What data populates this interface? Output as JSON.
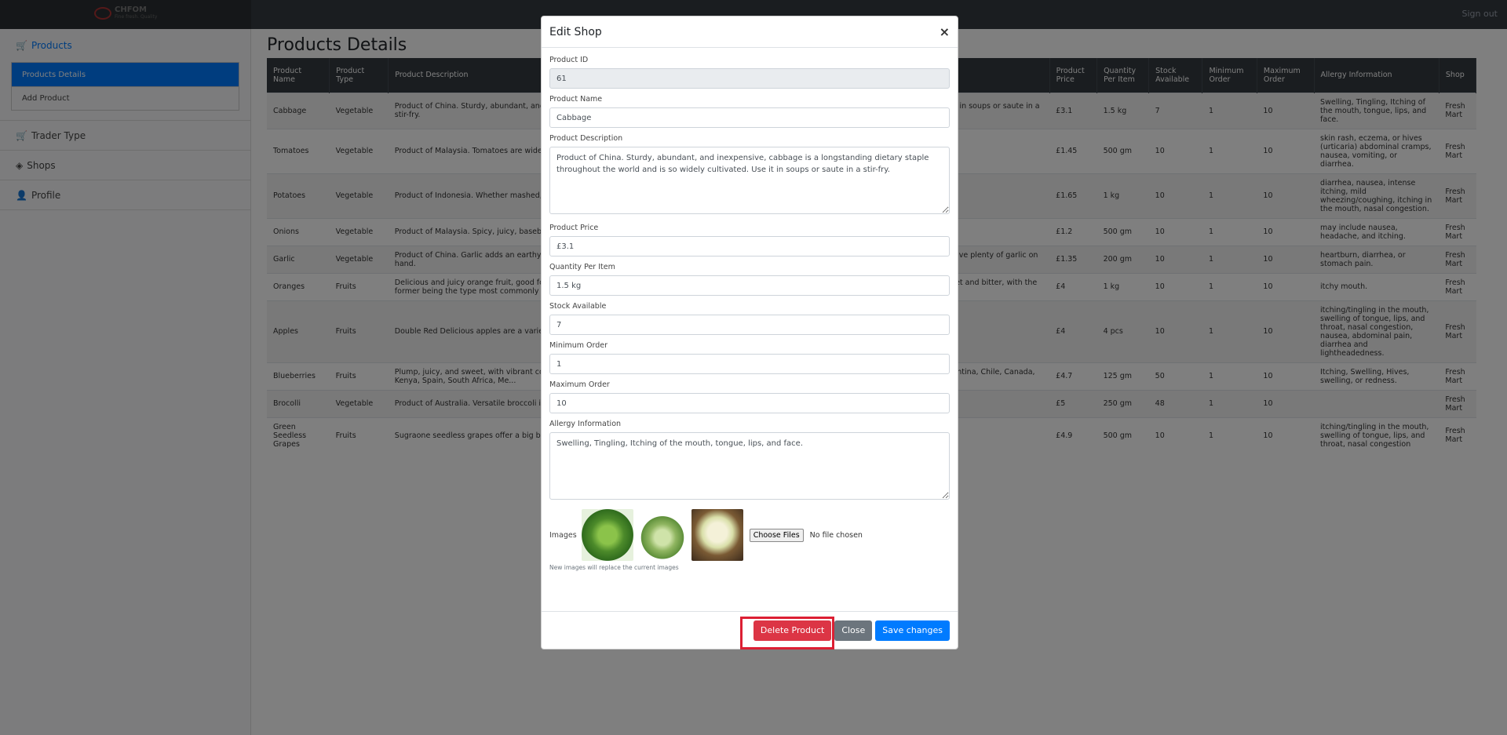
{
  "topbar": {
    "logo_text": "CHFOM",
    "logo_sub": "Fine fresh. Quality",
    "signout": "Sign out"
  },
  "sidebar": {
    "products": "Products",
    "products_details": "Products Details",
    "add_product": "Add Product",
    "trader_type": "Trader Type",
    "shops": "Shops",
    "profile": "Profile"
  },
  "main": {
    "title": "Products Details",
    "columns": [
      "Product Name",
      "Product Type",
      "Product Description",
      "Product Price",
      "Quantity Per Item",
      "Stock Available",
      "Minimum Order",
      "Maximum Order",
      "Allergy Information",
      "Shop"
    ],
    "rows": [
      {
        "name": "Cabbage",
        "type": "Vegetable",
        "desc": "Product of China. Sturdy, abundant, and inexpensive, cabbage is a longstanding dietary staple throughout the world and is so widely cultivated. Use it in soups or saute in a stir-fry.",
        "price": "£3.1",
        "qty": "1.5 kg",
        "stock": "7",
        "min": "1",
        "max": "10",
        "allergy": "Swelling, Tingling, Itching of the mouth, tongue, lips, and face.",
        "shop": "Fresh Mart"
      },
      {
        "name": "Tomatoes",
        "type": "Vegetable",
        "desc": "Product of Malaysia. Tomatoes are widely known...",
        "price": "£1.45",
        "qty": "500 gm",
        "stock": "10",
        "min": "1",
        "max": "10",
        "allergy": "skin rash, eczema, or hives (urticaria) abdominal cramps, nausea, vomiting, or diarrhea.",
        "shop": "Fresh Mart"
      },
      {
        "name": "Potatoes",
        "type": "Vegetable",
        "desc": "Product of Indonesia. Whether mashed, baked... vegetable crop in the world. Potatoes are available year-round as they are harvested...",
        "price": "£1.65",
        "qty": "1 kg",
        "stock": "10",
        "min": "1",
        "max": "10",
        "allergy": "diarrhea, nausea, intense itching, mild wheezing/coughing, itching in the mouth, nasal congestion.",
        "shop": "Fresh Mart"
      },
      {
        "name": "Onions",
        "type": "Vegetable",
        "desc": "Product of Malaysia. Spicy, juicy, baseball-sized... with flour and deep-fry for decadent onion rings. These tear-inducing onions are...",
        "price": "£1.2",
        "qty": "500 gm",
        "stock": "10",
        "min": "1",
        "max": "10",
        "allergy": "may include nausea, headache, and itching.",
        "shop": "Fresh Mart"
      },
      {
        "name": "Garlic",
        "type": "Vegetable",
        "desc": "Product of China. Garlic adds an earthy, robust... biting, and fresh. Garlic can also be roasted whole for a nutty and mellow flavor... ty flavor. Always have plenty of garlic on hand.",
        "price": "£1.35",
        "qty": "200 gm",
        "stock": "10",
        "min": "1",
        "max": "10",
        "allergy": "heartburn, diarrhea, or stomach pain.",
        "shop": "Fresh Mart"
      },
      {
        "name": "Oranges",
        "type": "Fruits",
        "desc": "Delicious and juicy orange fruit, good for juice... and overall well-being. Orange is a tropical to semitropical, evergreen, small flowering... egories, sweet and bitter, with the former being the type most commonly consumed.",
        "price": "£4",
        "qty": "1 kg",
        "stock": "10",
        "min": "1",
        "max": "10",
        "allergy": "itchy mouth.",
        "shop": "Fresh Mart"
      },
      {
        "name": "Apples",
        "type": "Fruits",
        "desc": "Double Red Delicious apples are a variety of... Red Delicious apple, with a bright white flesh, aromatic and sweet flavor and...",
        "price": "£4",
        "qty": "4 pcs",
        "stock": "10",
        "min": "1",
        "max": "10",
        "allergy": "itching/tingling in the mouth, swelling of tongue, lips, and throat, nasal congestion, nausea, abdominal pain, diarrhea and lightheadedness.",
        "shop": "Fresh Mart"
      },
      {
        "name": "Blueberries",
        "type": "Fruits",
        "desc": "Plump, juicy, and sweet, with vibrant colours... of nature\\'s great treasures. Blueberries have a sweet flavour that\\'s deli... orocco, USA, Australia, Argentina, Chile, Canada, Kenya, Spain, South Africa, Me...",
        "price": "£4.7",
        "qty": "125 gm",
        "stock": "50",
        "min": "1",
        "max": "10",
        "allergy": "Itching, Swelling, Hives, swelling, or redness.",
        "shop": "Fresh Mart"
      },
      {
        "name": "Brocolli",
        "type": "Vegetable",
        "desc": "Product of Australia. Versatile broccoli is deli...",
        "price": "£5",
        "qty": "250 gm",
        "stock": "48",
        "min": "1",
        "max": "10",
        "allergy": "",
        "shop": "Fresh Mart"
      },
      {
        "name": "Green Seedless Grapes",
        "type": "Fruits",
        "desc": "Sugraone seedless grapes offer a big burst o... es and large, oval, and creamy white with excellent firmness berries.",
        "price": "£4.9",
        "qty": "500 gm",
        "stock": "10",
        "min": "1",
        "max": "10",
        "allergy": "itching/tingling in the mouth, swelling of tongue, lips, and throat, nasal congestion",
        "shop": "Fresh Mart"
      }
    ]
  },
  "modal": {
    "title": "Edit Shop",
    "close_symbol": "×",
    "fields": {
      "product_id": {
        "label": "Product ID",
        "value": "61"
      },
      "product_name": {
        "label": "Product Name",
        "value": "Cabbage"
      },
      "product_description": {
        "label": "Product Description",
        "value": "Product of China. Sturdy, abundant, and inexpensive, cabbage is a longstanding dietary staple throughout the world and is so widely cultivated. Use it in soups or saute in a stir-fry."
      },
      "product_price": {
        "label": "Product Price",
        "value": "£3.1"
      },
      "quantity_per_item": {
        "label": "Quantity Per Item",
        "value": "1.5 kg"
      },
      "stock_available": {
        "label": "Stock Available",
        "value": "7"
      },
      "minimum_order": {
        "label": "Minimum Order",
        "value": "1"
      },
      "maximum_order": {
        "label": "Maximum Order",
        "value": "10"
      },
      "allergy_information": {
        "label": "Allergy Information",
        "value": "Swelling, Tingling, Itching of the mouth, tongue, lips, and face."
      }
    },
    "images_label": "Images",
    "choose_files": "Choose Files",
    "file_status": "No file chosen",
    "help_text": "New images will replace the current images",
    "buttons": {
      "delete": "Delete Product",
      "close": "Close",
      "save": "Save changes"
    }
  },
  "colors": {
    "danger": "#dc3545",
    "secondary": "#6c757d",
    "primary": "#007bff",
    "highlight": "#dc1f33"
  }
}
